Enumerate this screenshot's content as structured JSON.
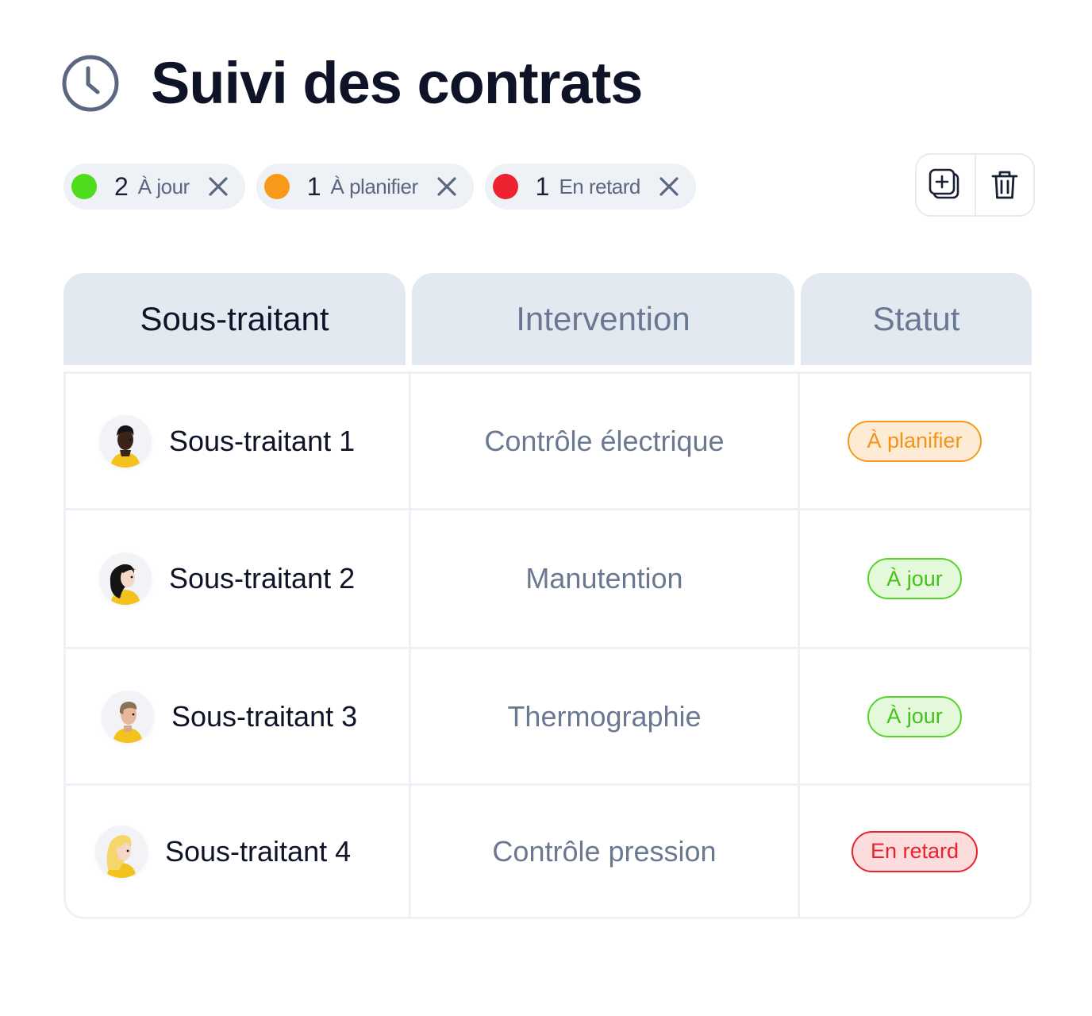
{
  "page": {
    "title": "Suivi des contrats",
    "title_icon": "clock-icon"
  },
  "filters": [
    {
      "count": "2",
      "label": "À jour",
      "color": "#4fdc1c",
      "close_icon": "close-icon"
    },
    {
      "count": "1",
      "label": "À planifier",
      "color": "#f79a1a",
      "close_icon": "close-icon"
    },
    {
      "count": "1",
      "label": "En retard",
      "color": "#ef2231",
      "close_icon": "close-icon"
    }
  ],
  "toolbar": {
    "add_icon": "add-copy-icon",
    "delete_icon": "trash-icon"
  },
  "table": {
    "headers": [
      "Sous-traitant",
      "Intervention",
      "Statut"
    ],
    "rows": [
      {
        "name": "Sous-traitant 1",
        "intervention": "Contrôle électrique",
        "status": "À planifier",
        "status_color": "#f29418"
      },
      {
        "name": "Sous-traitant 2",
        "intervention": "Manutention",
        "status": "À jour",
        "status_color": "#45c21a"
      },
      {
        "name": "Sous-traitant 3",
        "intervention": "Thermographie",
        "status": "À jour",
        "status_color": "#45c21a"
      },
      {
        "name": "Sous-traitant 4",
        "intervention": "Contrôle pression",
        "status": "En retard",
        "status_color": "#e8232b"
      }
    ]
  }
}
